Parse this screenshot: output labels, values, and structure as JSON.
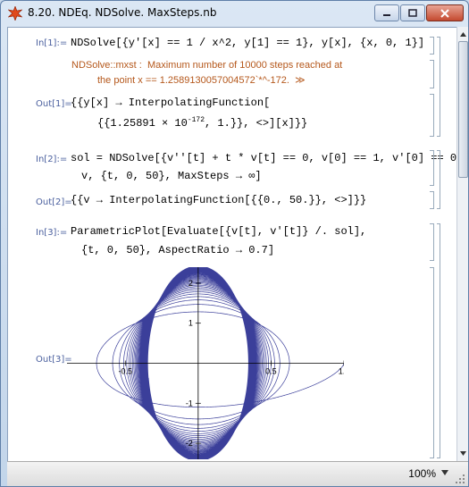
{
  "window": {
    "title": "8.20. NDEq. NDSolve. MaxSteps.nb"
  },
  "status": {
    "zoom": "100%"
  },
  "cells": {
    "in1": {
      "label": "In[1]:=",
      "code": "NDSolve[{y'[x] == 1 / x^2, y[1] == 1}, y[x], {x, 0, 1}]"
    },
    "msg1": {
      "line1": "NDSolve::mxst :  Maximum number of 10000 steps reached at",
      "line2": "the point x == 1.2589130057004572`*^-172.  ≫"
    },
    "out1": {
      "label": "Out[1]=",
      "line1": "{{y[x] → InterpolatingFunction[",
      "line2": "{{1.25891 × 10",
      "line2_exp": "-172",
      "line2_rest": ", 1.}}, <>][x]}}"
    },
    "in2": {
      "label": "In[2]:=",
      "line1": "sol = NDSolve[{v''[t] + t * v[t] == 0, v[0] == 1, v'[0] == 0},",
      "line2": "v, {t, 0, 50}, MaxSteps → ∞]"
    },
    "out2": {
      "label": "Out[2]=",
      "code": "{{v → InterpolatingFunction[{{0., 50.}}, <>]}}"
    },
    "in3": {
      "label": "In[3]:=",
      "line1": "ParametricPlot[Evaluate[{v[t], v'[t]} /. sol],",
      "line2": "{t, 0, 50}, AspectRatio → 0.7]"
    },
    "out3": {
      "label": "Out[3]="
    }
  },
  "chart_data": {
    "type": "line",
    "title": "",
    "xlabel": "",
    "ylabel": "",
    "xlim": [
      -0.9,
      1.0
    ],
    "ylim": [
      -2.4,
      2.4
    ],
    "x_ticks": [
      "-0.5",
      "0.5",
      "1.0"
    ],
    "y_ticks": [
      "2",
      "1",
      "-1",
      "-2"
    ],
    "series": [
      {
        "points": [
          [
            1.0,
            0.0
          ],
          [
            0.7,
            -0.55
          ],
          [
            0.45,
            -1.0
          ],
          [
            0.1,
            -1.6
          ],
          [
            -0.3,
            -1.0
          ],
          [
            -0.55,
            0.0
          ],
          [
            -0.35,
            1.1
          ],
          [
            0.0,
            1.55
          ],
          [
            0.35,
            1.3
          ],
          [
            0.5,
            0.0
          ],
          [
            0.35,
            -1.6
          ],
          [
            0.0,
            -2.1
          ],
          [
            -0.35,
            -1.6
          ],
          [
            -0.45,
            0.0
          ],
          [
            -0.35,
            1.7
          ],
          [
            0.0,
            2.2
          ],
          [
            0.35,
            1.7
          ],
          [
            0.45,
            0.0
          ]
        ]
      }
    ],
    "colors": {
      "curve": "#3b3f9a",
      "axis": "#000000"
    }
  }
}
